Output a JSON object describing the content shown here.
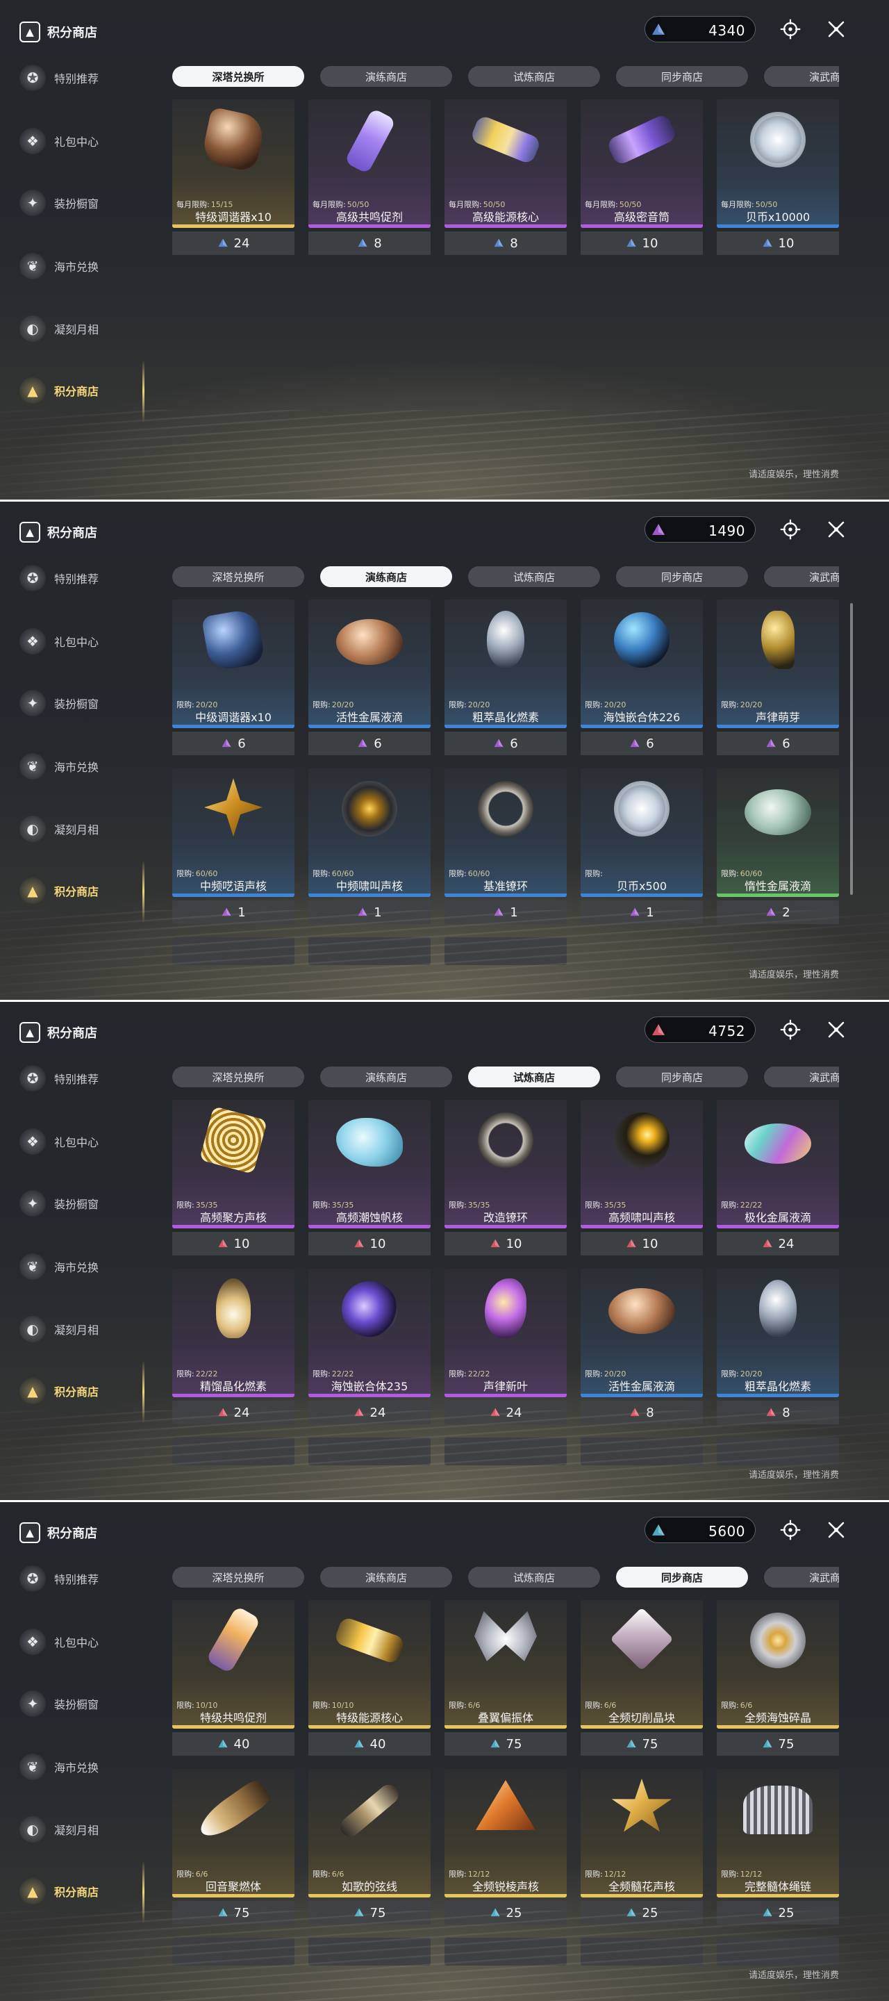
{
  "app": {
    "shop_title": "积分商店",
    "footer_note": "请适度娱乐，理性消费",
    "sidebar": [
      {
        "label": "特别推荐",
        "icon": "award-icon"
      },
      {
        "label": "礼包中心",
        "icon": "gift-icon"
      },
      {
        "label": "装扮橱窗",
        "icon": "wardrobe-icon"
      },
      {
        "label": "海市兑换",
        "icon": "coral-icon"
      },
      {
        "label": "凝刻月相",
        "icon": "moon-icon"
      },
      {
        "label": "积分商店",
        "icon": "triangle-emblem-icon"
      }
    ],
    "tabs": [
      "深塔兑换所",
      "演练商店",
      "试炼商店",
      "同步商店",
      "演武商店"
    ]
  },
  "colors": {
    "gold": "#e6c65a",
    "purple": "#b05ce0",
    "blue": "#3f84d8",
    "green": "#6ac56a",
    "active_side": "#f3d77a"
  },
  "panels": [
    {
      "active_tab": 0,
      "currency": {
        "amount": "4340",
        "color": "#5b8bd6"
      },
      "items": [
        {
          "name": "特级调谐器x10",
          "limit_label": "每月限购:",
          "limit": "15/15",
          "price": "24",
          "rarity": "gold",
          "art": "crystal"
        },
        {
          "name": "高级共鸣促剂",
          "limit_label": "每月限购:",
          "limit": "50/50",
          "price": "8",
          "rarity": "purple",
          "art": "vial"
        },
        {
          "name": "高级能源核心",
          "limit_label": "每月限购:",
          "limit": "50/50",
          "price": "8",
          "rarity": "purple",
          "art": "cylinder"
        },
        {
          "name": "高级密音筒",
          "limit_label": "每月限购:",
          "limit": "50/50",
          "price": "10",
          "rarity": "purple",
          "art": "purplecyl"
        },
        {
          "name": "贝币x10000",
          "limit_label": "每月限购:",
          "limit": "50/50",
          "price": "10",
          "rarity": "blue",
          "art": "coin"
        }
      ],
      "stubs": 0,
      "scrollbar": false
    },
    {
      "active_tab": 1,
      "currency": {
        "amount": "1490",
        "color": "#a45ed6"
      },
      "items": [
        {
          "name": "中级调谐器x10",
          "limit_label": "限购:",
          "limit": "20/20",
          "price": "6",
          "rarity": "blue",
          "art": "bluecrystal"
        },
        {
          "name": "活性金属液滴",
          "limit_label": "限购:",
          "limit": "20/20",
          "price": "6",
          "rarity": "blue",
          "art": "bronze"
        },
        {
          "name": "粗萃晶化燃素",
          "limit_label": "限购:",
          "limit": "20/20",
          "price": "6",
          "rarity": "blue",
          "art": "silver"
        },
        {
          "name": "海蚀嵌合体226",
          "limit_label": "限购:",
          "limit": "20/20",
          "price": "6",
          "rarity": "blue",
          "art": "orb"
        },
        {
          "name": "声律萌芽",
          "limit_label": "限购:",
          "limit": "20/20",
          "price": "6",
          "rarity": "blue",
          "art": "sprout"
        },
        {
          "name": "中频呓语声核",
          "limit_label": "限购:",
          "limit": "60/60",
          "price": "1",
          "rarity": "blue",
          "art": "star"
        },
        {
          "name": "中频啸叫声核",
          "limit_label": "限购:",
          "limit": "60/60",
          "price": "1",
          "rarity": "blue",
          "art": "darkcore"
        },
        {
          "name": "基准镣环",
          "limit_label": "限购:",
          "limit": "60/60",
          "price": "1",
          "rarity": "blue",
          "art": "ring"
        },
        {
          "name": "贝币x500",
          "limit_label": "限购:",
          "limit": "",
          "price": "1",
          "rarity": "blue",
          "art": "coin"
        },
        {
          "name": "惰性金属液滴",
          "limit_label": "限购:",
          "limit": "60/60",
          "price": "2",
          "rarity": "green",
          "art": "shell"
        }
      ],
      "stubs": 3,
      "scrollbar": true
    },
    {
      "active_tab": 2,
      "currency": {
        "amount": "4752",
        "color": "#e0566a"
      },
      "items": [
        {
          "name": "高频聚方声核",
          "limit_label": "限购:",
          "limit": "35/35",
          "price": "10",
          "rarity": "purple",
          "art": "goldcube"
        },
        {
          "name": "高频潮蚀帆核",
          "limit_label": "限购:",
          "limit": "35/35",
          "price": "10",
          "rarity": "purple",
          "art": "blueflower"
        },
        {
          "name": "改造镣环",
          "limit_label": "限购:",
          "limit": "35/35",
          "price": "10",
          "rarity": "purple",
          "art": "ring"
        },
        {
          "name": "高频啸叫声核",
          "limit_label": "限购:",
          "limit": "35/35",
          "price": "10",
          "rarity": "purple",
          "art": "goldorb"
        },
        {
          "name": "极化金属液滴",
          "limit_label": "限购:",
          "limit": "22/22",
          "price": "24",
          "rarity": "purple",
          "art": "rainbow"
        },
        {
          "name": "精馏晶化燃素",
          "limit_label": "限购:",
          "limit": "22/22",
          "price": "24",
          "rarity": "purple",
          "art": "flame"
        },
        {
          "name": "海蚀嵌合体235",
          "limit_label": "限购:",
          "limit": "22/22",
          "price": "24",
          "rarity": "purple",
          "art": "purplesphere"
        },
        {
          "name": "声律新叶",
          "limit_label": "限购:",
          "limit": "22/22",
          "price": "24",
          "rarity": "purple",
          "art": "purpleleaf"
        },
        {
          "name": "活性金属液滴",
          "limit_label": "限购:",
          "limit": "20/20",
          "price": "8",
          "rarity": "blue",
          "art": "bronze"
        },
        {
          "name": "粗萃晶化燃素",
          "limit_label": "限购:",
          "limit": "20/20",
          "price": "8",
          "rarity": "blue",
          "art": "silver"
        }
      ],
      "stubs": 5,
      "scrollbar": false
    },
    {
      "active_tab": 3,
      "currency": {
        "amount": "5600",
        "color": "#4fb3c8"
      },
      "items": [
        {
          "name": "特级共鸣促剂",
          "limit_label": "限购:",
          "limit": "10/10",
          "price": "40",
          "rarity": "gold",
          "art": "bigvial"
        },
        {
          "name": "特级能源核心",
          "limit_label": "限购:",
          "limit": "10/10",
          "price": "40",
          "rarity": "gold",
          "art": "goldcyl"
        },
        {
          "name": "叠翼偏振体",
          "limit_label": "限购:",
          "limit": "6/6",
          "price": "75",
          "rarity": "gold",
          "art": "butterfly"
        },
        {
          "name": "全频切削晶块",
          "limit_label": "限购:",
          "limit": "6/6",
          "price": "75",
          "rarity": "gold",
          "art": "cube"
        },
        {
          "name": "全频海蚀碎晶",
          "limit_label": "限购:",
          "limit": "6/6",
          "price": "75",
          "rarity": "gold",
          "art": "goldcoin"
        },
        {
          "name": "回音聚燃体",
          "limit_label": "限购:",
          "limit": "6/6",
          "price": "75",
          "rarity": "gold",
          "art": "drill"
        },
        {
          "name": "如歌的弦线",
          "limit_label": "限购:",
          "limit": "6/6",
          "price": "75",
          "rarity": "gold",
          "art": "flute"
        },
        {
          "name": "全频锐棱声核",
          "limit_label": "限购:",
          "limit": "12/12",
          "price": "25",
          "rarity": "gold",
          "art": "triangle"
        },
        {
          "name": "全频髓花声核",
          "limit_label": "限购:",
          "limit": "12/12",
          "price": "25",
          "rarity": "gold",
          "art": "goldstar"
        },
        {
          "name": "完整髓体绳链",
          "limit_label": "限购:",
          "limit": "12/12",
          "price": "25",
          "rarity": "gold",
          "art": "chain"
        }
      ],
      "stubs": 5,
      "scrollbar": false
    }
  ]
}
